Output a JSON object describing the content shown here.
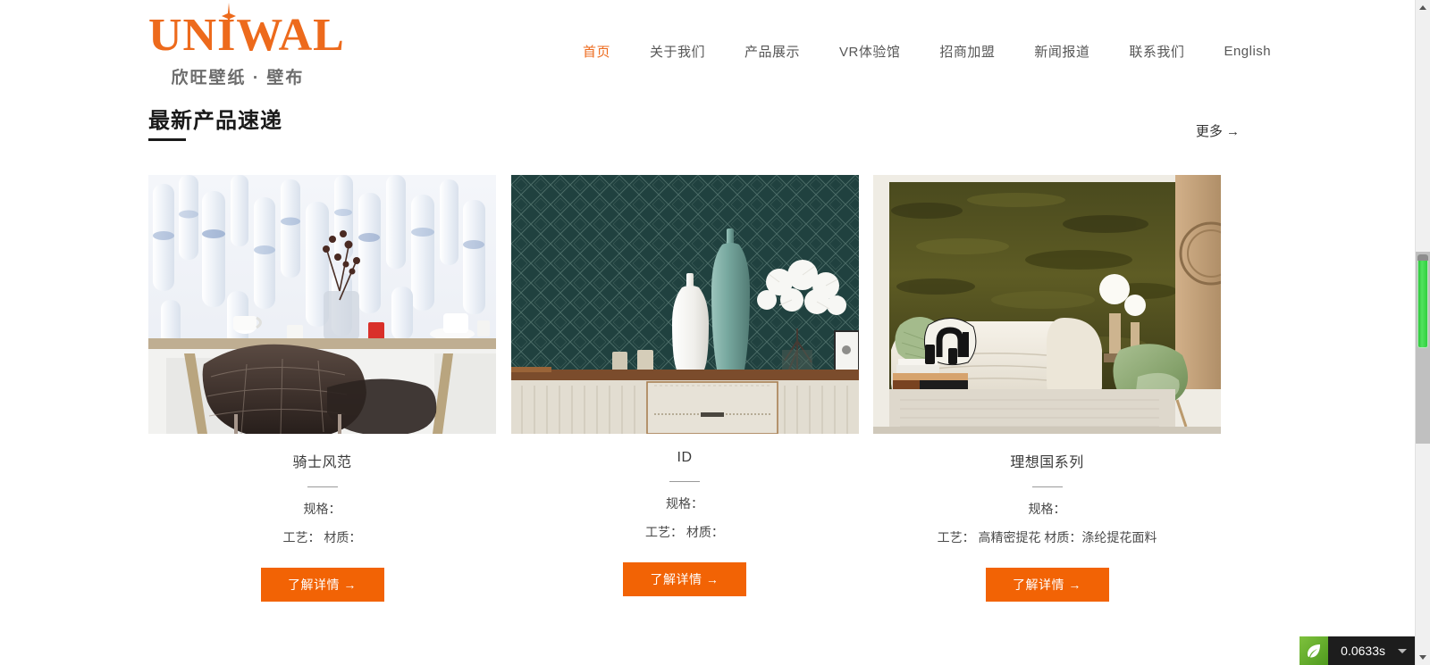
{
  "brand": {
    "logo_text": "UNIWAL",
    "logo_subtext": "欣旺壁纸 · 壁布",
    "accent_color": "#ED6A1C",
    "button_color": "#F26305"
  },
  "nav": {
    "items": [
      {
        "label": "首页",
        "active": true
      },
      {
        "label": "关于我们",
        "active": false
      },
      {
        "label": "产品展示",
        "active": false
      },
      {
        "label": "VR体验馆",
        "active": false
      },
      {
        "label": "招商加盟",
        "active": false
      },
      {
        "label": "新闻报道",
        "active": false
      },
      {
        "label": "联系我们",
        "active": false
      },
      {
        "label": "English",
        "active": false
      }
    ]
  },
  "section": {
    "title": "最新产品速递",
    "more_label": "更多  →"
  },
  "products": [
    {
      "title": "骑士风范",
      "spec_label": "规格：",
      "meta": "工艺： 材质：",
      "button_label": "了解详情  →",
      "image_alt": "dining-room-blue-cylinder-wallpaper"
    },
    {
      "title": "ID",
      "spec_label": "规格：",
      "meta": "工艺： 材质：",
      "button_label": "了解详情  →",
      "image_alt": "teal-lattice-wallpaper-vases"
    },
    {
      "title": "理想国系列",
      "spec_label": "规格：",
      "meta": "工艺： 高精密提花 材质：涤纶提花面料",
      "button_label": "了解详情  →",
      "image_alt": "olive-green-textured-wall-living-room"
    }
  ],
  "debug": {
    "load_time": "0.0633s",
    "leaf_icon": "leaf-icon",
    "caret_icon": "chevron-down-icon"
  },
  "scrollbar": {
    "up_icon": "scroll-up-arrow-icon",
    "down_icon": "scroll-down-arrow-icon"
  }
}
